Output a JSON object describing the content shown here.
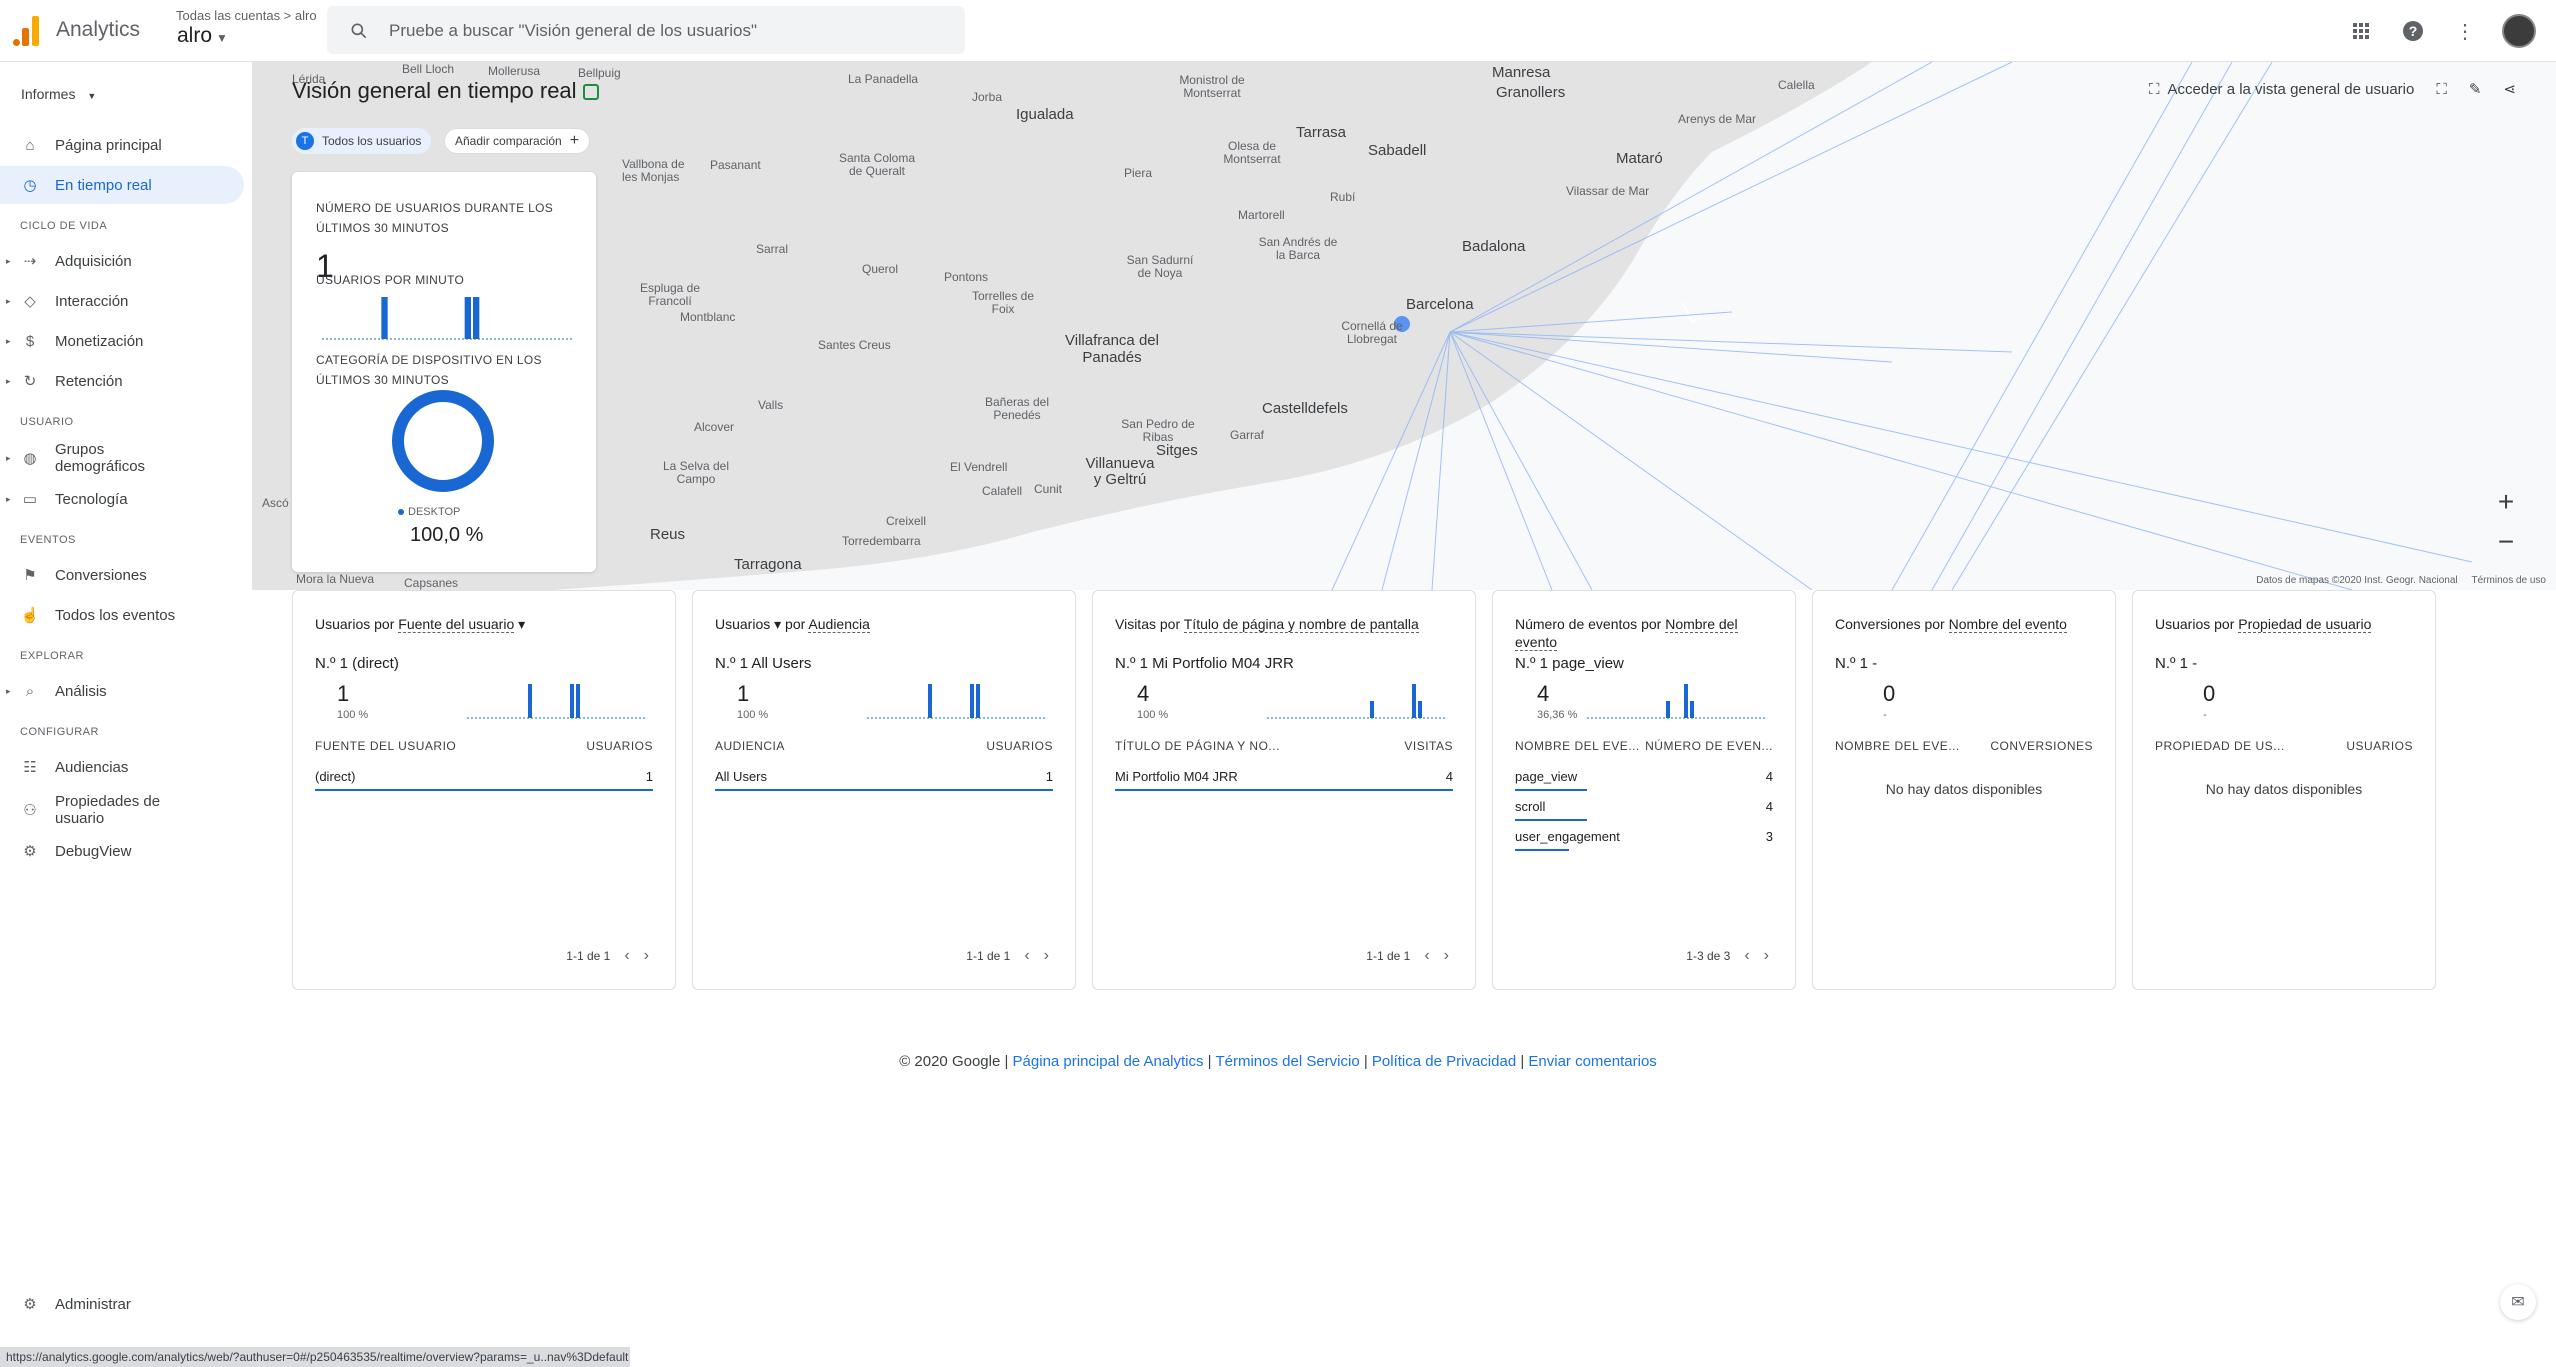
{
  "app": {
    "brand": "Analytics",
    "crumb": "Todas las cuentas > alro",
    "account": "alro",
    "search_placeholder": "Pruebe a buscar \"Visión general de los usuarios\""
  },
  "sidebar": {
    "informes": "Informes",
    "items": [
      {
        "label": "Página principal",
        "icon": "home-icon"
      },
      {
        "label": "En tiempo real",
        "icon": "clock-icon"
      }
    ],
    "ciclo_label": "CICLO DE VIDA",
    "ciclo": [
      {
        "label": "Adquisición"
      },
      {
        "label": "Interacción"
      },
      {
        "label": "Monetización"
      },
      {
        "label": "Retención"
      }
    ],
    "usuario_label": "USUARIO",
    "usuario": [
      {
        "label": "Grupos demográficos"
      },
      {
        "label": "Tecnología"
      }
    ],
    "eventos_label": "EVENTOS",
    "eventos": [
      {
        "label": "Conversiones"
      },
      {
        "label": "Todos los eventos"
      }
    ],
    "explorar_label": "EXPLORAR",
    "explorar": [
      {
        "label": "Análisis"
      }
    ],
    "configurar_label": "CONFIGURAR",
    "configurar": [
      {
        "label": "Audiencias"
      },
      {
        "label": "Propiedades de usuario"
      },
      {
        "label": "DebugView"
      }
    ],
    "admin": "Administrar"
  },
  "map": {
    "title": "Visión general en tiempo real",
    "chip_all": "Todos los usuarios",
    "chip_all_badge": "T",
    "chip_add": "Añadir comparación",
    "snapshot": "Acceder a la vista general de usuario",
    "attribution": "Datos de mapas ©2020 Inst. Geogr. Nacional",
    "terms": "Términos de uso",
    "labels": [
      "Lérida",
      "Bell Lloch",
      "Mollerusa",
      "Bellpuig",
      "La Panadella",
      "Jorba",
      "Igualada",
      "Monistrol de Montserrat",
      "Manresa",
      "Granollers",
      "Calella",
      "Arenys de Mar",
      "Vallbona de les Monjas",
      "Pasanant",
      "Santa Coloma de Queralt",
      "Piera",
      "Olesa de Montserrat",
      "Tarrasa",
      "Sabadell",
      "Mataró",
      "Vilassar de Mar",
      "Rubí",
      "Martorell",
      "Sarral",
      "Querol",
      "Espluga de Francolí",
      "Pontons",
      "Torrelles de Foix",
      "San Sadurní de Noya",
      "San Andrés de la Barca",
      "Badalona",
      "Montblanc",
      "Barcelona",
      "Cornellá de Llobregat",
      "Santes Creus",
      "Villafranca del Panadés",
      "Valls",
      "Bañeras del Penedés",
      "Castelldefels",
      "Alcover",
      "San Pedro de Ribas",
      "Garraf",
      "Sitges",
      "La Selva del Campo",
      "El Vendrell",
      "Villanueva y Geltrú",
      "Calafell",
      "Cunit",
      "Reus",
      "Creixell",
      "Torredembarra",
      "Tarragona",
      "Mora la Nueva",
      "Capsanes",
      "Ascó"
    ]
  },
  "realtime": {
    "users_header": "NÚMERO DE USUARIOS DURANTE LOS ÚLTIMOS 30 MINUTOS",
    "users_value": "1",
    "per_minute_header": "USUARIOS POR MINUTO",
    "device_header": "CATEGORÍA DE DISPOSITIVO EN LOS ÚLTIMOS 30 MINUTOS",
    "device_legend": "DESKTOP",
    "device_pct": "100,0 %",
    "per_minute_bars": [
      0,
      0,
      0,
      0,
      0,
      0,
      0,
      1,
      0,
      0,
      0,
      0,
      0,
      0,
      0,
      0,
      0,
      1,
      1,
      0,
      0,
      0,
      0,
      0,
      0,
      0,
      0,
      0,
      0,
      0
    ]
  },
  "cards": [
    {
      "title_a": "Usuarios por ",
      "title_b": "Fuente del usuario",
      "title_caret": "▾",
      "rank": "N.º 1  (direct)",
      "num": "1",
      "sub": "100 %",
      "col1": "FUENTE DEL USUARIO",
      "col2": "USUARIOS",
      "rows": [
        {
          "k": "(direct)",
          "v": "1",
          "fill": 1.0
        }
      ],
      "pager": "1-1 de 1",
      "bars": [
        0,
        0,
        0,
        0,
        0,
        0,
        0,
        0,
        0,
        0,
        1,
        0,
        0,
        0,
        0,
        0,
        0,
        1,
        1,
        0,
        0,
        0,
        0,
        0,
        0,
        0,
        0,
        0,
        0,
        0
      ]
    },
    {
      "title_a": "Usuarios ▾ por ",
      "title_b": "Audiencia",
      "title_caret": "",
      "rank": "N.º 1  All Users",
      "num": "1",
      "sub": "100 %",
      "col1": "AUDIENCIA",
      "col2": "USUARIOS",
      "rows": [
        {
          "k": "All Users",
          "v": "1",
          "fill": 1.0
        }
      ],
      "pager": "1-1 de 1",
      "bars": [
        0,
        0,
        0,
        0,
        0,
        0,
        0,
        0,
        0,
        0,
        1,
        0,
        0,
        0,
        0,
        0,
        0,
        1,
        1,
        0,
        0,
        0,
        0,
        0,
        0,
        0,
        0,
        0,
        0,
        0
      ]
    },
    {
      "title_a": "Visitas por ",
      "title_b": "Título de página y nombre de pantalla",
      "title_caret": "",
      "rank": "N.º 1  Mi Portfolio M04 JRR",
      "num": "4",
      "sub": "100 %",
      "col1": "TÍTULO DE PÁGINA Y NO...",
      "col2": "VISITAS",
      "rows": [
        {
          "k": "Mi Portfolio M04 JRR",
          "v": "4",
          "fill": 1.0
        }
      ],
      "pager": "1-1 de 1",
      "bars": [
        0,
        0,
        0,
        0,
        0,
        0,
        0,
        0,
        0,
        0,
        0,
        0,
        0,
        0,
        0,
        0,
        0,
        1,
        0,
        0,
        0,
        0,
        0,
        0,
        2,
        1,
        0,
        0,
        0,
        0
      ]
    },
    {
      "title_a": "Número de eventos por ",
      "title_b": "Nombre del evento",
      "title_caret": "",
      "rank": "N.º 1  page_view",
      "num": "4",
      "sub": "36,36 %",
      "col1": "NOMBRE DEL EVE...",
      "col2": "NÚMERO DE EVEN...",
      "rows": [
        {
          "k": "page_view",
          "v": "4",
          "fill": 1.0
        },
        {
          "k": "scroll",
          "v": "4",
          "fill": 1.0
        },
        {
          "k": "user_engagement",
          "v": "3",
          "fill": 0.75
        }
      ],
      "pager": "1-3 de 3",
      "bars": [
        0,
        0,
        0,
        0,
        0,
        0,
        0,
        0,
        0,
        0,
        0,
        0,
        0,
        1,
        0,
        0,
        2,
        1,
        0,
        0,
        0,
        0,
        0,
        0,
        0,
        0,
        0,
        0,
        0,
        0
      ]
    },
    {
      "title_a": "Conversiones por ",
      "title_b": "Nombre del evento",
      "title_caret": "",
      "rank": "N.º 1  -",
      "num": "0",
      "sub": "-",
      "col1": "NOMBRE DEL EVE...",
      "col2": "CONVERSIONES",
      "nodata": "No hay datos disponibles"
    },
    {
      "title_a": "Usuarios por ",
      "title_b": "Propiedad de usuario",
      "title_caret": "",
      "rank": "N.º 1  -",
      "num": "0",
      "sub": "-",
      "col1": "PROPIEDAD DE US...",
      "col2": "USUARIOS",
      "nodata": "No hay datos disponibles"
    }
  ],
  "footer": {
    "copyright": "© 2020 Google | ",
    "link1": "Página principal de Analytics",
    "link2": "Términos del Servicio",
    "link3": "Política de Privacidad",
    "link4": "Enviar comentarios",
    "sep": " | "
  },
  "status_url": "https://analytics.google.com/analytics/web/?authuser=0#/p250463535/realtime/overview?params=_u..nav%3Ddefault",
  "colors": {
    "accent": "#1967d2",
    "bars": "#1967d2",
    "active_bg": "#e8f0fe"
  }
}
